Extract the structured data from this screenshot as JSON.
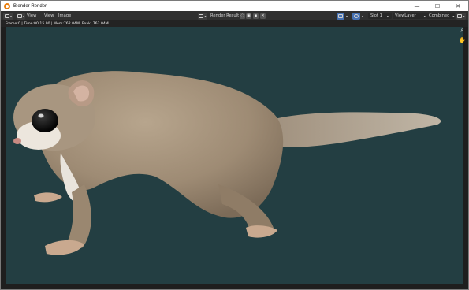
{
  "window": {
    "title": "Blender Render",
    "minimize_glyph": "—",
    "maximize_glyph": "☐",
    "close_glyph": "✕"
  },
  "header": {
    "menus": [
      "View",
      "View",
      "Image"
    ],
    "image_name": "Render Result",
    "slot": "Slot 1",
    "view_layer": "ViewLayer",
    "pass": "Combined"
  },
  "status": {
    "text": "Frame:0 | Time:00:15.90 | Mem:762.04M, Peak: 762.04M"
  },
  "viewport": {
    "background_color": "#233e42",
    "subject": "flying squirrel render"
  },
  "colors": {
    "accent": "#4772b3",
    "blender_orange": "#e87d0d"
  }
}
